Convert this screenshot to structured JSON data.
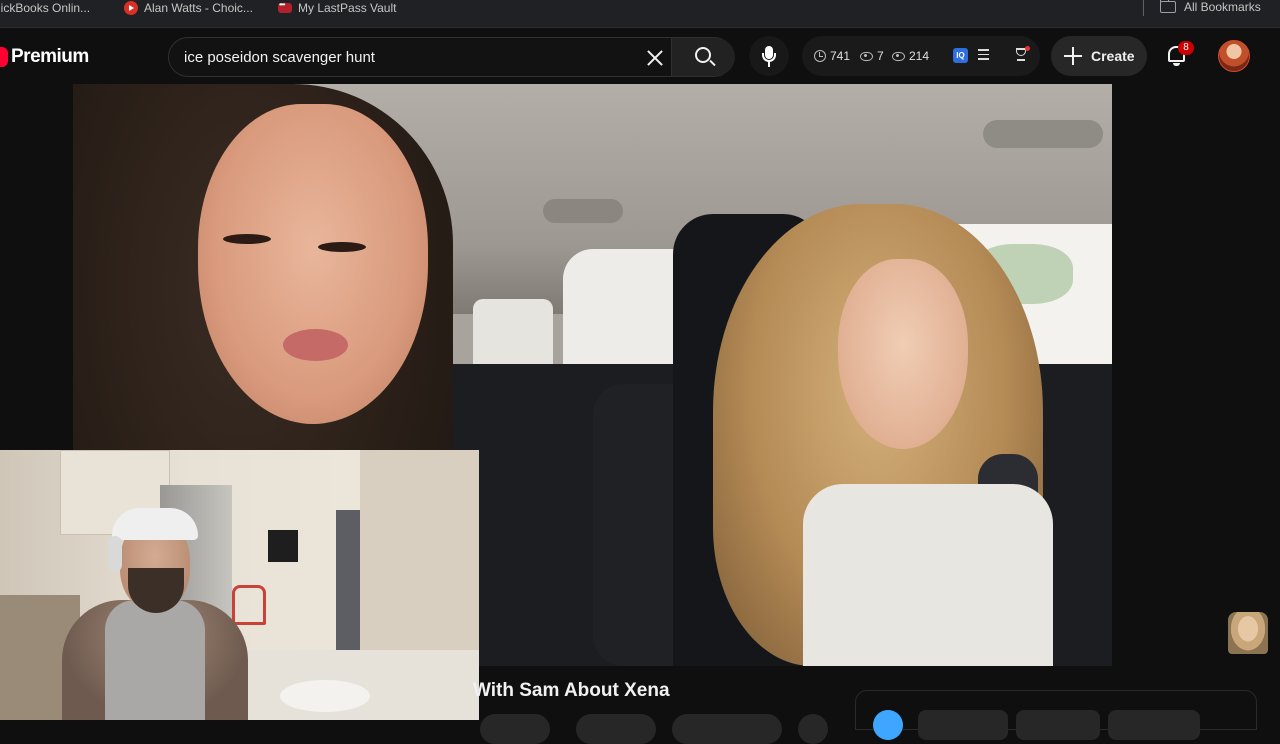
{
  "bookmarks": {
    "items": [
      {
        "label": "uickBooks Onlin...",
        "icon": "quickbooks-icon"
      },
      {
        "label": "Alan Watts - Choic...",
        "icon": "youtube-icon"
      },
      {
        "label": "My LastPass Vault",
        "icon": "lastpass-icon"
      }
    ],
    "all_bookmarks_label": "All Bookmarks"
  },
  "header": {
    "logo_label": "Premium",
    "search": {
      "value": "ice poseidon scavenger hunt",
      "placeholder": "Search"
    },
    "extension_stats": {
      "clock_count": "741",
      "eye_count_a": "7",
      "eye_count_b": "214"
    },
    "create_label": "Create",
    "notification_count": "8"
  },
  "video": {
    "title": "With Sam About Xena"
  },
  "colors": {
    "accent_red": "#ff0033",
    "badge_red": "#cc0000",
    "background": "#0f0f0f",
    "link_blue": "#3ea6ff"
  }
}
